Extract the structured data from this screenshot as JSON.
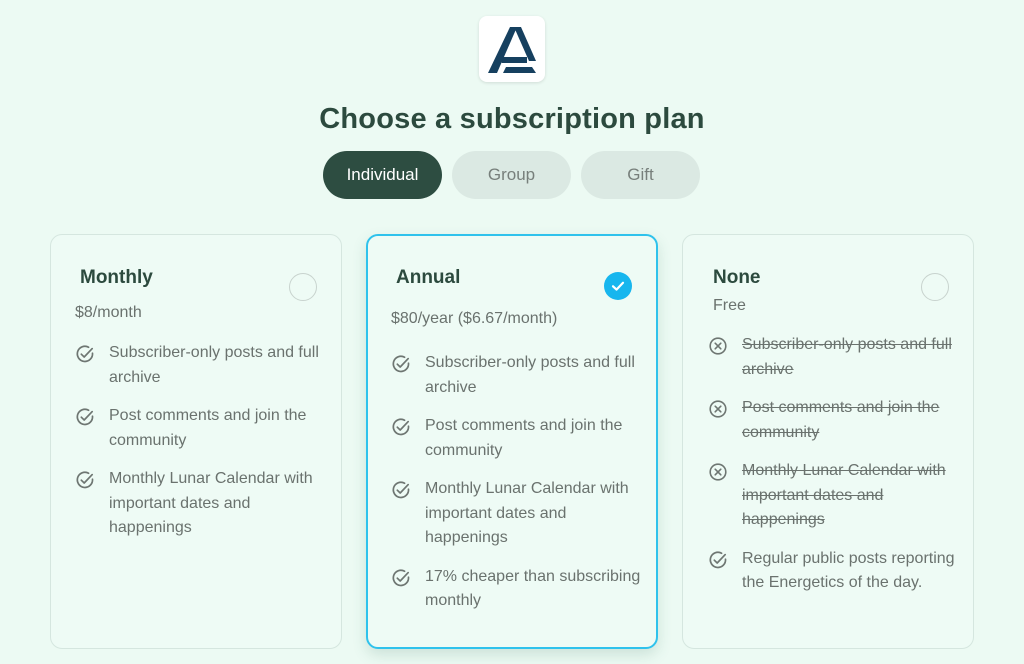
{
  "header": {
    "logo_icon": "brand-logo-icon",
    "title": "Choose a subscription plan"
  },
  "tabs": [
    {
      "label": "Individual",
      "active": true
    },
    {
      "label": "Group",
      "active": false
    },
    {
      "label": "Gift",
      "active": false
    }
  ],
  "colors": {
    "background": "#ecfaf3",
    "accent_dark": "#2d4d41",
    "selected_border": "#2fc2ec",
    "check_fill": "#17b6ee"
  },
  "plans": [
    {
      "name": "Monthly",
      "price": "$8/month",
      "selected": false,
      "features": [
        {
          "text": "Subscriber-only posts and full archive",
          "included": true
        },
        {
          "text": "Post comments and join the community",
          "included": true
        },
        {
          "text": "Monthly Lunar Calendar with important dates and happenings",
          "included": true
        }
      ]
    },
    {
      "name": "Annual",
      "price": "$80/year ($6.67/month)",
      "selected": true,
      "features": [
        {
          "text": "Subscriber-only posts and full archive",
          "included": true
        },
        {
          "text": "Post comments and join the community",
          "included": true
        },
        {
          "text": "Monthly Lunar Calendar with important dates and happenings",
          "included": true
        },
        {
          "text": "17% cheaper than subscribing monthly",
          "included": true
        }
      ]
    },
    {
      "name": "None",
      "price": "Free",
      "selected": false,
      "features": [
        {
          "text": "Subscriber-only posts and full archive",
          "included": false
        },
        {
          "text": "Post comments and join the community",
          "included": false
        },
        {
          "text": "Monthly Lunar Calendar with important dates and happenings",
          "included": false
        },
        {
          "text": "Regular public posts reporting the Energetics of the day.",
          "included": true
        }
      ]
    }
  ]
}
